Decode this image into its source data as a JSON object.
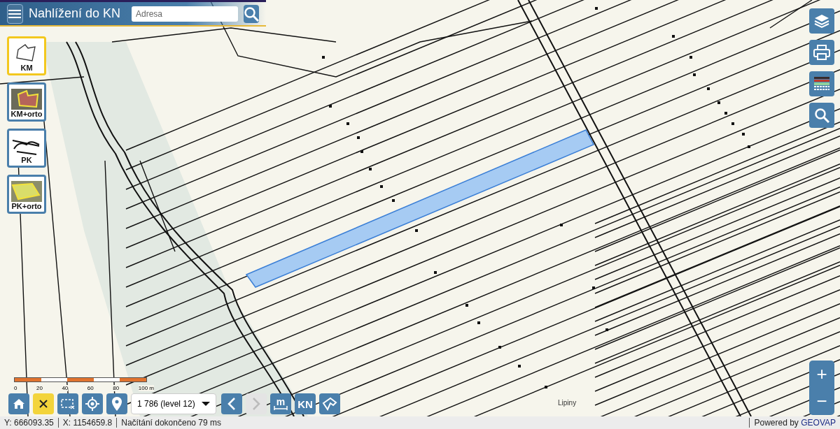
{
  "header": {
    "title": "Nahlížení do KN",
    "search": {
      "placeholder": "Adresa"
    }
  },
  "layers": [
    {
      "label": "KM",
      "kind": "km",
      "selected": true
    },
    {
      "label": "KM+orto",
      "kind": "km-orto",
      "selected": false
    },
    {
      "label": "PK",
      "kind": "pk",
      "selected": false
    },
    {
      "label": "PK+orto",
      "kind": "pk-orto",
      "selected": false
    }
  ],
  "right_tools": [
    {
      "kind": "layers"
    },
    {
      "kind": "print"
    },
    {
      "kind": "legend"
    },
    {
      "kind": "search"
    }
  ],
  "zoom": {
    "in": "+",
    "out": "−"
  },
  "map": {
    "place_label": "Lipiny"
  },
  "scale_bar": {
    "labels": [
      "0",
      "20",
      "40",
      "60",
      "80",
      "100 m"
    ]
  },
  "toolbar": [
    {
      "kind": "home",
      "disabled": false
    },
    {
      "kind": "clear",
      "disabled": false
    },
    {
      "kind": "select",
      "disabled": false
    },
    {
      "kind": "locate",
      "disabled": false
    },
    {
      "kind": "pin",
      "disabled": false
    },
    {
      "kind": "scale",
      "value": "1 786 (level 12)"
    },
    {
      "kind": "back",
      "disabled": false
    },
    {
      "kind": "next",
      "disabled": true
    },
    {
      "kind": "measure",
      "label": "m",
      "disabled": false
    },
    {
      "kind": "text",
      "label": "KN",
      "disabled": false
    },
    {
      "kind": "polygon",
      "disabled": false
    }
  ],
  "status_bar": {
    "y": "Y: 666093.35",
    "x": "X: 1154659.8",
    "message": "Načítání dokončeno 79 ms",
    "powered_by": "Powered by",
    "brand": "GEOVAP"
  }
}
